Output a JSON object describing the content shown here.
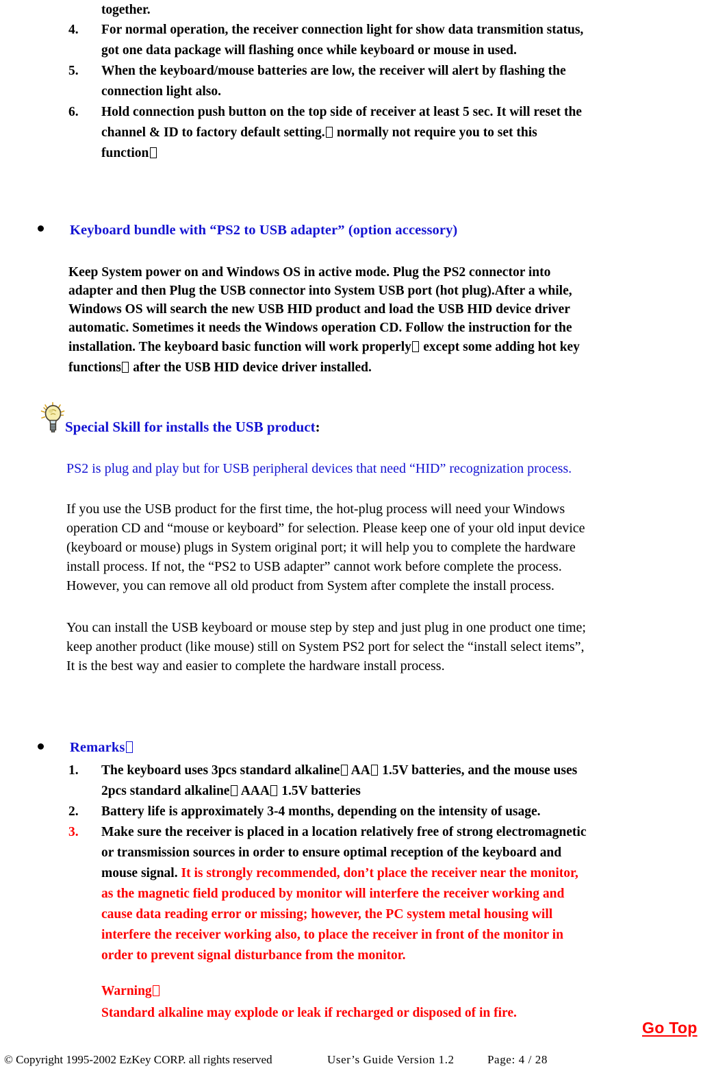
{
  "document": {
    "type": "scanned-manual-page",
    "colors": {
      "text_black": "#000000",
      "heading_blue": "#1414d2",
      "warning_red": "#fe0000",
      "background": "#ffffff"
    }
  },
  "top_list": {
    "continued_line": "together.",
    "items": [
      {
        "marker": "4.",
        "lines": [
          "For normal operation, the receiver connection light for show data transmition status,",
          "got one data package will flashing once while keyboard or mouse in used."
        ]
      },
      {
        "marker": "5.",
        "lines": [
          "When the keyboard/mouse batteries are low, the receiver will alert by flashing the",
          "connection light also."
        ]
      },
      {
        "marker": "6.",
        "lines": [
          "Hold connection push button on the top side of receiver at least 5 sec. It will reset the",
          "channel & ID to factory default setting.",
          "normally not require you to set this",
          "function"
        ]
      }
    ]
  },
  "section_adapter": {
    "bullet_heading": "Keyboard bundle with “PS2 to USB adapter” (option accessory)",
    "paragraph_lines": [
      "Keep System power on and Windows OS in active mode. Plug the PS2 connector into",
      "adapter and then Plug the USB connector into System USB port (hot plug).After a while,",
      "Windows OS will search the new USB HID product and load the USB HID device driver",
      "automatic. Sometimes it needs the Windows operation CD. Follow the instruction for the",
      "installation. The keyboard basic function will work properly",
      "except some adding hot key",
      "functions",
      "after the USB HID device driver installed."
    ]
  },
  "special_skill": {
    "icon": "lightbulb-icon",
    "heading": "Special Skill for installs the USB product",
    "heading_colon": ":",
    "blue_line": "PS2 is plug and play but for USB peripheral devices that need “HID” recognization process.",
    "paragraph_1": [
      "If you use the USB product for the first time, the hot-plug process will need your Windows",
      "operation CD and “mouse or keyboard” for selection. Please keep one of your old input device",
      "(keyboard or mouse) plugs in System original port; it will help you to complete the hardware",
      "install process. If not, the “PS2 to USB adapter” cannot work before complete the process.",
      "However, you can remove all old product from System after complete the install process."
    ],
    "paragraph_2": [
      "You can install the USB keyboard or mouse step by step and just plug in one product one time;",
      "keep another product (like mouse) still on System PS2 port for select the “install select items”,",
      "It is the best way and easier to complete the hardware install process."
    ]
  },
  "remarks": {
    "bullet_heading": "Remarks",
    "items": [
      {
        "marker": "1.",
        "marker_color": "#000000",
        "lines": [
          "The keyboard uses 3pcs standard alkaline",
          "AA",
          "1.5V batteries, and the mouse uses",
          "2pcs standard alkaline",
          "AAA",
          "1.5V batteries"
        ]
      },
      {
        "marker": "2.",
        "marker_color": "#000000",
        "lines": [
          "Battery life is approximately 3-4 months, depending on the intensity of usage."
        ]
      },
      {
        "marker": "3.",
        "marker_color": "#fe0000",
        "black_lines": [
          "Make sure the receiver is placed in a location relatively free of strong electromagnetic",
          "or transmission sources in order to ensure optimal reception of the keyboard and",
          "mouse signal."
        ],
        "red_inline": "It is strongly recommended, don’t place the receiver near the monitor,",
        "red_lines": [
          "as the magnetic field produced by monitor will interfere the receiver working and",
          "cause data reading error or missing; however, the PC system metal housing will",
          "interfere the receiver working also, to place the receiver in front of the monitor in",
          "order to prevent signal disturbance from the monitor."
        ]
      }
    ],
    "warning": {
      "title": "Warning",
      "text": "Standard alkaline may explode or leak if recharged or disposed of in fire."
    }
  },
  "go_top": {
    "label": "Go Top"
  },
  "footer": {
    "copyright": "© Copyright 1995-2002 EzKey CORP. all rights reserved",
    "guide": "User’s  Guide  Version  1.2",
    "page": "Page:  4 / 28"
  }
}
